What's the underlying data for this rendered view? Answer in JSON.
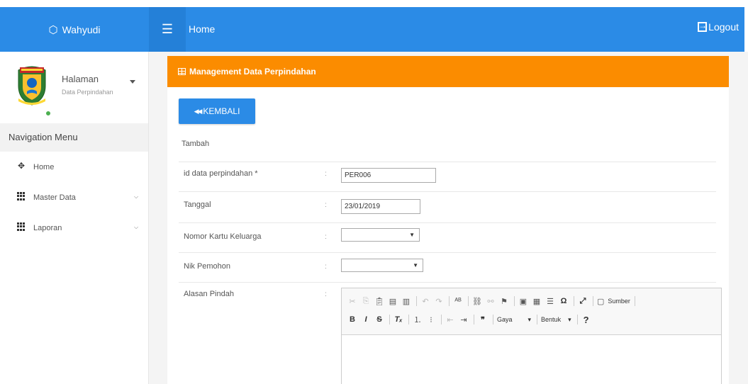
{
  "topbar": {
    "brand": "Wahyudi",
    "page_title": "Home",
    "logout_label": "Logout"
  },
  "sidebar": {
    "profile_name": "Halaman",
    "profile_sub": "Data Perpindahan",
    "nav_header": "Navigation Menu",
    "items": [
      {
        "label": "Home",
        "icon": "arrows-move-icon"
      },
      {
        "label": "Master Data",
        "icon": "grid-icon",
        "has_submenu": true
      },
      {
        "label": "Laporan",
        "icon": "grid-icon",
        "has_submenu": true
      }
    ]
  },
  "panel": {
    "heading": "Management Data Perpindahan",
    "back_label": "KEMBALI",
    "subtitle": "Tambah",
    "colon": ":",
    "fields": [
      {
        "label": "id data perpindahan *",
        "value": "PER006"
      },
      {
        "label": "Tanggal",
        "value": "23/01/2019"
      },
      {
        "label": "Nomor Kartu Keluarga",
        "value": ""
      },
      {
        "label": "Nik Pemohon",
        "value": ""
      },
      {
        "label": "Alasan Pindah"
      }
    ],
    "editor": {
      "source_label": "Sumber",
      "style_label": "Gaya",
      "format_label": "Bentuk",
      "help_label": "?"
    }
  },
  "colors": {
    "topbar": "#2b8be6",
    "panel_heading": "#fb8c00",
    "button": "#2b8be6"
  }
}
